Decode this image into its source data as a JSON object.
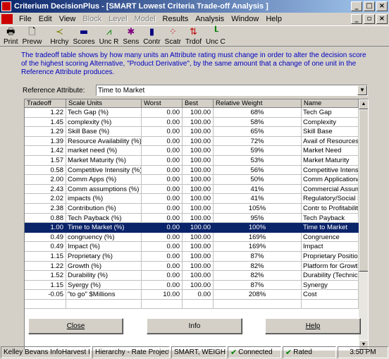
{
  "window": {
    "title": "Criterium DecisionPlus - [SMART Lowest Criteria Trade-off Analysis ]"
  },
  "window_controls": [
    "_",
    "□",
    "×"
  ],
  "child_controls": [
    "_",
    "▫",
    "×"
  ],
  "menu": [
    {
      "label": "File",
      "enabled": true
    },
    {
      "label": "Edit",
      "enabled": true
    },
    {
      "label": "View",
      "enabled": true
    },
    {
      "label": "Block",
      "enabled": false
    },
    {
      "label": "Level",
      "enabled": false
    },
    {
      "label": "Model",
      "enabled": false
    },
    {
      "label": "Results",
      "enabled": true
    },
    {
      "label": "Analysis",
      "enabled": true
    },
    {
      "label": "Window",
      "enabled": true
    },
    {
      "label": "Help",
      "enabled": true
    }
  ],
  "toolbar": [
    {
      "label": "Print",
      "icon": "printer-icon",
      "glyph": "🖶",
      "color": "#000000"
    },
    {
      "label": "Prevw",
      "icon": "preview-icon",
      "glyph": "🗋",
      "color": "#000000"
    },
    {
      "label": "Hrchy",
      "icon": "hierarchy-icon",
      "glyph": "≺",
      "color": "#808000"
    },
    {
      "label": "Scores",
      "icon": "scores-icon",
      "glyph": "▬",
      "color": "#000080"
    },
    {
      "label": "Unc R",
      "icon": "uncertainty-ratings-icon",
      "glyph": "⩘",
      "color": "#008000"
    },
    {
      "label": "Sens",
      "icon": "sensitivity-icon",
      "glyph": "✱",
      "color": "#800080"
    },
    {
      "label": "Contr",
      "icon": "contributions-icon",
      "glyph": "▮",
      "color": "#000080"
    },
    {
      "label": "Scatr",
      "icon": "scatter-icon",
      "glyph": "⁘",
      "color": "#c00000"
    },
    {
      "label": "Trdof",
      "icon": "tradeoff-icon",
      "glyph": "⇅",
      "color": "#c00000"
    },
    {
      "label": "Unc C",
      "icon": "uncertainty-criteria-icon",
      "glyph": "┖",
      "color": "#008000"
    }
  ],
  "description": "The tradeoff table shows by how many units an Attribute rating must change in order to alter the decision score of the highest scoring Alternative, \"Product Derivative\", by the same amount that a change of one unit in the Reference Attribute produces.",
  "reference": {
    "label": "Reference Attribute:",
    "value": "Time to Market"
  },
  "table": {
    "columns": [
      "Tradeoff",
      "Scale Units",
      "Worst",
      "Best",
      "Relative Weight",
      "Name"
    ],
    "rows": [
      [
        "1.22",
        "Tech Gap (%)",
        "0.00",
        "100.00",
        "68%",
        "Tech Gap"
      ],
      [
        "1.45",
        "complexity (%)",
        "0.00",
        "100.00",
        "58%",
        "Complexity"
      ],
      [
        "1.29",
        "Skill Base (%)",
        "0.00",
        "100.00",
        "65%",
        "Skill Base"
      ],
      [
        "1.39",
        "Resource Availability (%)",
        "0.00",
        "100.00",
        "72%",
        "Avail of Resources"
      ],
      [
        "1.42",
        "market need (%)",
        "0.00",
        "100.00",
        "59%",
        "Market Need"
      ],
      [
        "1.57",
        "Market Maturity (%)",
        "0.00",
        "100.00",
        "53%",
        "Market Maturity"
      ],
      [
        "0.58",
        "Competitive Intensity (%)",
        "0.00",
        "100.00",
        "56%",
        "Competitive Intensity"
      ],
      [
        "2.00",
        "Comm Apps (%)",
        "0.00",
        "100.00",
        "50%",
        "Comm Application/Develop S"
      ],
      [
        "2.43",
        "Comm assumptions (%)",
        "0.00",
        "100.00",
        "41%",
        "Commercial Assumptions"
      ],
      [
        "2.02",
        "impacts (%)",
        "0.00",
        "100.00",
        "41%",
        "Regulatory/Social Political Im"
      ],
      [
        "2.38",
        "Contribution (%)",
        "0.00",
        "100.00",
        "105%",
        "Contr to Profitability"
      ],
      [
        "0.88",
        "Tech Payback (%)",
        "0.00",
        "100.00",
        "95%",
        "Tech Payback"
      ],
      [
        "1.00",
        "Time to Market (%)",
        "0.00",
        "100.00",
        "100%",
        "Time to Market"
      ],
      [
        "0.49",
        "congruency (%)",
        "0.00",
        "100.00",
        "169%",
        "Congruence"
      ],
      [
        "0.49",
        "Impact (%)",
        "0.00",
        "100.00",
        "169%",
        "Impact"
      ],
      [
        "1.15",
        "Proprietary (%)",
        "0.00",
        "100.00",
        "87%",
        "Proprietary Position"
      ],
      [
        "1.22",
        "Growth (%)",
        "0.00",
        "100.00",
        "82%",
        "Platform for Growth"
      ],
      [
        "1.52",
        "Durability (%)",
        "0.00",
        "100.00",
        "82%",
        "Durability (Technical and Ma"
      ],
      [
        "1.15",
        "Syergy (%)",
        "0.00",
        "100.00",
        "87%",
        "Synergy"
      ],
      [
        "-0.05",
        "\"to go\" $Millions",
        "10.00",
        "0.00",
        "208%",
        "Cost"
      ],
      [
        "",
        "",
        "",
        "",
        "",
        ""
      ]
    ],
    "selected_row": 12
  },
  "buttons": {
    "close": "Close",
    "info": "Info",
    "help": "Help"
  },
  "status": {
    "user": "Kelley Bevans InfoHarvest Inc.",
    "model": "Hierarchy - Rate Projects",
    "method": "SMART, WEIGHTS",
    "connected": "Connected",
    "rated": "Rated",
    "time": "3:50 PM"
  }
}
